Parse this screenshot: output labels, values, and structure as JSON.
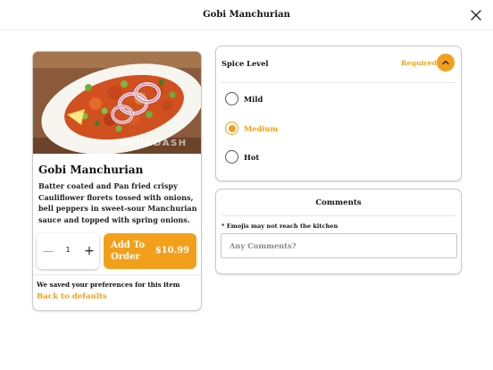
{
  "modal": {
    "title": "Gobi Manchurian",
    "close_icon": "close-icon"
  },
  "item": {
    "image_icon": "food-photo",
    "image_watermark": "DOORDASH",
    "name": "Gobi Manchurian",
    "description": "Batter coated and Pan fried crispy Cauliflower florets tossed with onions, bell peppers in sweet-sour Manchurian sauce and topped with spring onions.",
    "quantity": {
      "value": "1",
      "minus_icon": "minus-icon",
      "plus_icon": "plus-icon"
    },
    "add_button": {
      "label": "Add To Order",
      "price": "$10.99"
    },
    "preferences_note": "We saved your preferences for this item",
    "reset_link": "Back to defaults"
  },
  "spice": {
    "title": "Spice Level",
    "required_label": "Required",
    "toggle_icon": "chevron-up-icon",
    "options": [
      {
        "label": "Mild",
        "selected": false
      },
      {
        "label": "Medium",
        "selected": true
      },
      {
        "label": "Hot",
        "selected": false
      }
    ]
  },
  "comments": {
    "title": "Comments",
    "note": "* Emojis may not reach the kitchen",
    "value": "",
    "placeholder": "Any Comments?"
  },
  "colors": {
    "accent": "#f2a01c",
    "border": "#c9c9c9",
    "text": "#111111"
  }
}
